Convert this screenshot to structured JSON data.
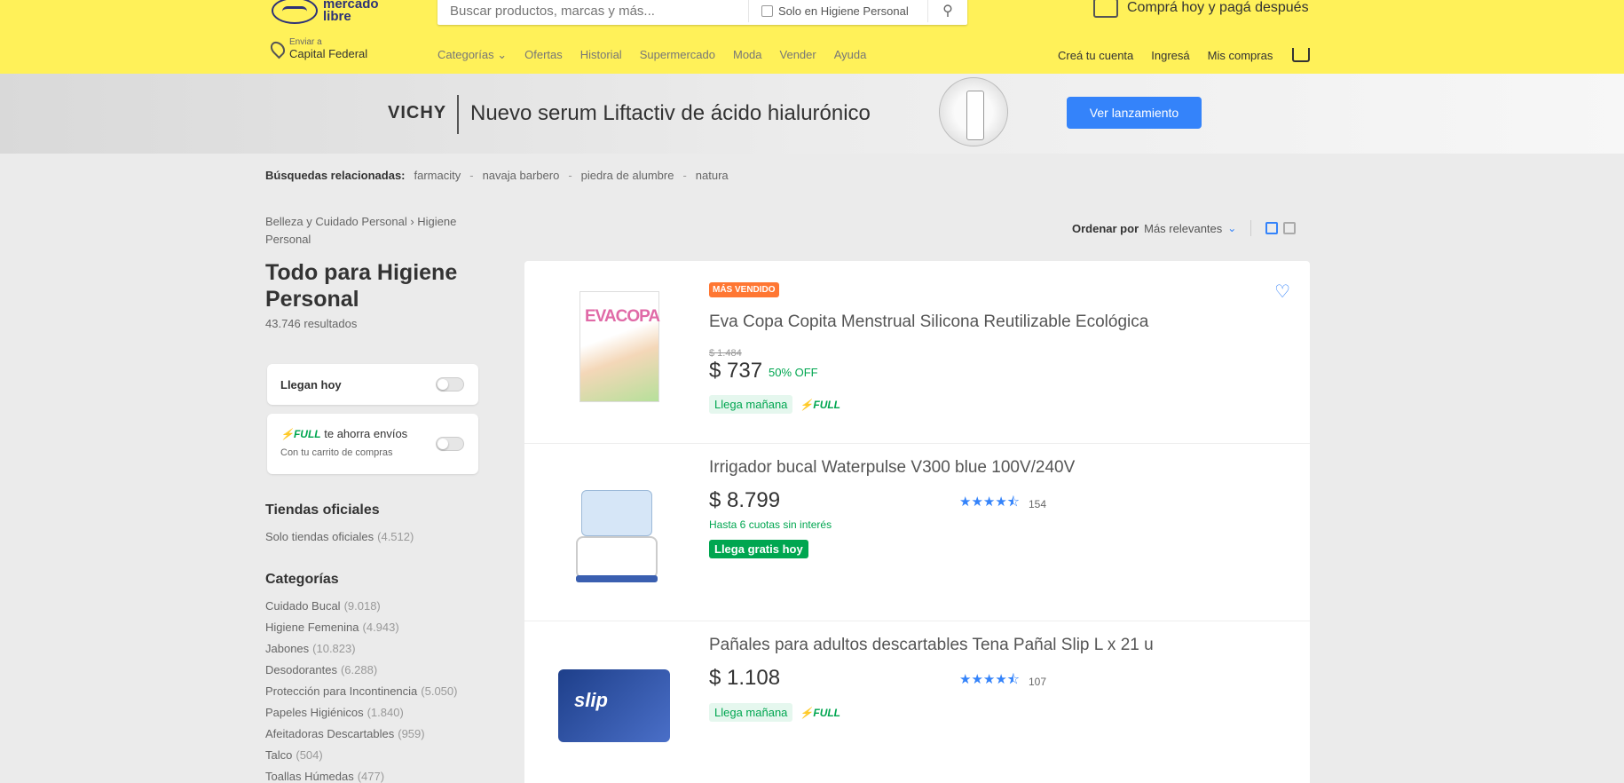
{
  "header": {
    "logo_line1": "mercado",
    "logo_line2": "libre",
    "search_placeholder": "Buscar productos, marcas y más...",
    "search_filter": "Solo en Higiene Personal",
    "promo": "Comprá hoy y pagá después",
    "location_label": "Enviar a",
    "location_value": "Capital Federal",
    "nav": [
      "Categorías",
      "Ofertas",
      "Historial",
      "Supermercado",
      "Moda",
      "Vender",
      "Ayuda"
    ],
    "account": [
      "Creá tu cuenta",
      "Ingresá",
      "Mis compras"
    ]
  },
  "banner": {
    "brand": "VICHY",
    "headline": "Nuevo serum Liftactiv de ácido hialurónico",
    "cta": "Ver lanzamiento"
  },
  "related": {
    "label": "Búsquedas relacionadas:",
    "items": [
      "farmacity",
      "navaja barbero",
      "piedra de alumbre",
      "natura"
    ]
  },
  "sidebar": {
    "breadcrumb": "Belleza y Cuidado Personal  ›  Higiene Personal",
    "title": "Todo para Higiene Personal",
    "results": "43.746 resultados",
    "filter_today": "Llegan hoy",
    "full_label": "FULL",
    "full_text": "te ahorra envíos",
    "full_sub": "Con tu carrito de compras",
    "stores_heading": "Tiendas oficiales",
    "stores_item": "Solo tiendas oficiales",
    "stores_count": "(4.512)",
    "categories_heading": "Categorías",
    "categories": [
      {
        "label": "Cuidado Bucal",
        "count": "(9.018)"
      },
      {
        "label": "Higiene Femenina",
        "count": "(4.943)"
      },
      {
        "label": "Jabones",
        "count": "(10.823)"
      },
      {
        "label": "Desodorantes",
        "count": "(6.288)"
      },
      {
        "label": "Protección para Incontinencia",
        "count": "(5.050)"
      },
      {
        "label": "Papeles Higiénicos",
        "count": "(1.840)"
      },
      {
        "label": "Afeitadoras Descartables",
        "count": "(959)"
      },
      {
        "label": "Talco",
        "count": "(504)"
      },
      {
        "label": "Toallas Húmedas",
        "count": "(477)"
      }
    ]
  },
  "sort": {
    "label": "Ordenar por",
    "value": "Más relevantes"
  },
  "products": [
    {
      "badge": "MÁS VENDIDO",
      "title": "Eva Copa Copita Menstrual Silicona Reutilizable Ecológica",
      "old_price": "$ 1.484",
      "price": "$ 737",
      "discount": "50% OFF",
      "shipping": "Llega mañana",
      "full": "FULL",
      "thumb_text": "EVACOPA"
    },
    {
      "title": "Irrigador bucal Waterpulse V300 blue 100V/240V",
      "price": "$ 8.799",
      "installments": "Hasta 6 cuotas sin interés",
      "shipping": "Llega gratis hoy",
      "rating": 4.5,
      "reviews": "154"
    },
    {
      "title": "Pañales para adultos descartables Tena Pañal Slip L x 21 u",
      "price": "$ 1.108",
      "shipping": "Llega mañana",
      "full": "FULL",
      "rating": 4.5,
      "reviews": "107",
      "thumb_text": "slip"
    }
  ],
  "colors": {
    "header_bg": "#fff159",
    "accent": "#3483fa",
    "green": "#00a650",
    "badge": "#ff7733"
  }
}
